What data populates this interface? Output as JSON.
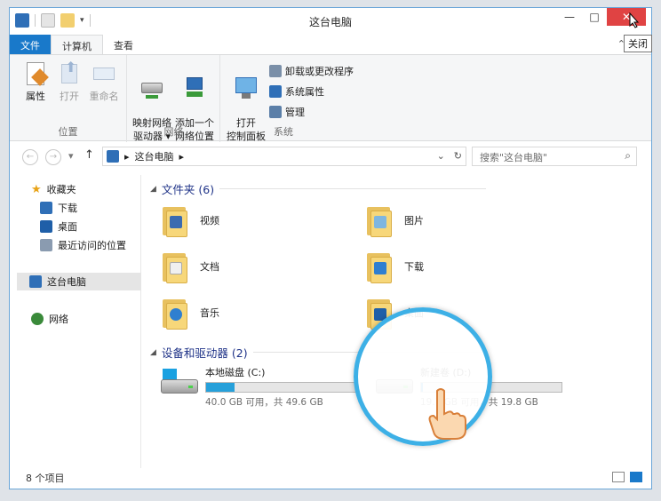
{
  "window": {
    "title": "这台电脑"
  },
  "titlebar": {
    "buttons": {
      "minimize": "—",
      "maximize": "□",
      "close": "✕"
    },
    "tooltip": "关闭"
  },
  "ribbon_tabs": [
    {
      "label": "文件"
    },
    {
      "label": "计算机"
    },
    {
      "label": "查看"
    }
  ],
  "ribbon": {
    "groups": [
      {
        "label": "位置",
        "buttons": [
          {
            "label": "属性"
          },
          {
            "label": "打开"
          },
          {
            "label": "重命名"
          }
        ]
      },
      {
        "label": "网络",
        "buttons": [
          {
            "label": "映射网络\n驱动器 ▾"
          },
          {
            "label": "添加一个\n网络位置"
          }
        ]
      },
      {
        "label": "系统",
        "buttons": [
          {
            "label": "打开\n控制面板"
          }
        ],
        "small_buttons": [
          {
            "label": "卸载或更改程序"
          },
          {
            "label": "系统属性"
          },
          {
            "label": "管理"
          }
        ]
      }
    ]
  },
  "address": {
    "breadcrumb": "这台电脑",
    "arrow": "▸",
    "search_placeholder": "搜索\"这台电脑\""
  },
  "navigation": {
    "favorites": {
      "label": "收藏夹",
      "items": [
        {
          "label": "下载"
        },
        {
          "label": "桌面"
        },
        {
          "label": "最近访问的位置"
        }
      ]
    },
    "this_pc": {
      "label": "这台电脑"
    },
    "network": {
      "label": "网络"
    }
  },
  "content": {
    "folders_header": "文件夹 (6)",
    "folders": [
      {
        "label": "视频"
      },
      {
        "label": "图片"
      },
      {
        "label": "文档"
      },
      {
        "label": "下载"
      },
      {
        "label": "音乐"
      },
      {
        "label": "桌面"
      }
    ],
    "drives_header": "设备和驱动器 (2)",
    "drives": [
      {
        "label": "本地磁盘 (C:)",
        "detail": "40.0 GB 可用，共 49.6 GB",
        "used_fraction": 0.19
      },
      {
        "label": "新建卷 (D:)",
        "detail": "19.7 GB 可用，共 19.8 GB",
        "used_fraction": 0.01
      }
    ]
  },
  "status": {
    "items_count": "8 个项目"
  },
  "colors": {
    "accent": "#1979ca",
    "close": "#e04343",
    "drive_fill": "#26a0da",
    "zoom_ring": "#3db0e6",
    "folder": "#f7d77a"
  }
}
